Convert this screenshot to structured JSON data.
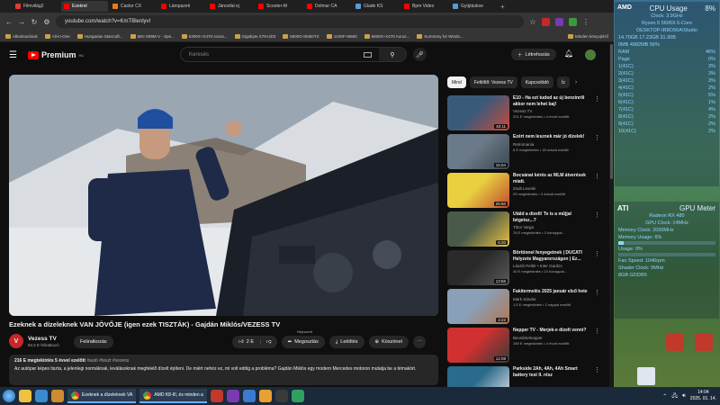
{
  "browser": {
    "tabs": [
      {
        "label": "Filmvilág2",
        "color": "#e53935"
      },
      {
        "label": "Ezekrel",
        "color": "#ff0000",
        "active": true
      },
      {
        "label": "Castor CX",
        "color": "#e87d18"
      },
      {
        "label": "Lámpazeti",
        "color": "#ff0000"
      },
      {
        "label": "Jánosfal ej",
        "color": "#ff0000"
      },
      {
        "label": "Scooter-M",
        "color": "#ff0000"
      },
      {
        "label": "Dolmar CA",
        "color": "#ff0000"
      },
      {
        "label": "Glade KS",
        "color": "#5b9bd5"
      },
      {
        "label": "Bpm Video",
        "color": "#ff0000"
      },
      {
        "label": "Gyújtáskoe",
        "color": "#5b9bd5"
      }
    ],
    "url": "youtube.com/watch?v=KmTBlenlyvI",
    "bookmarks": [
      "Alkalmazások",
      "All-in-One",
      "Hungarian Starcraft...",
      "MSI X99M-V - Spe...",
      "5300X+X470 Aorus...",
      "Gigabyte X79-UD3",
      "5600G+B350TX",
      "1240F+B660",
      "5600X+X470 Aorus...",
      "Summary for Windo..."
    ],
    "bookmarks_last": "Minden könyvjelző"
  },
  "youtube": {
    "logo": "Premium",
    "logo_sup": "HU",
    "search_placeholder": "Keresés",
    "create_label": "Létrehozás",
    "video_title": "Ezeknek a dízeleknek VAN JÖVŐJE (igen ezek TISZTÁK) - Gajdán Miklós/VEZESS TV",
    "channel": {
      "initial": "V",
      "name": "Vezess TV",
      "subs": "92,5 E feliratkozó"
    },
    "subscribe_label": "Feliratkozás",
    "tooltip": "Népszerű",
    "actions": {
      "like": "2 E",
      "share": "Megosztás",
      "download": "Letöltés",
      "thanks": "Köszönet",
      "more": "⋯"
    },
    "description": {
      "meta": "216 E megtekintés  5 évvel ezelőtt",
      "tags": "#autó #teszt #vezess",
      "text": "Az autópar képes tiszta, a jelenlegi normáknak, leválásoknak megfelelő dízelt építeni. De miért nehéz ez, mi volt eddig a probléma? Gajdán Miklós egy modern Mercedes motoron mutatja be a témakört."
    },
    "chips": [
      "Mind",
      "Feltöltő: Vezess TV",
      "Kapcsolódó",
      "Íz"
    ],
    "recommendations": [
      {
        "title": "E10 - Ha ezt tudod az új benzinről akkor nem lehet baj!",
        "channel": "Vezess TV",
        "meta": "201 E megtekintés • 4 évvel ezelőtt",
        "duration": "40:11",
        "c1": "#3a5a7a",
        "c2": "#c84a3a"
      },
      {
        "title": "Ezért nem lesznek már jó dízelek!",
        "channel": "Retromania",
        "meta": "6 E megtekintés • 18 órával ezelőtt",
        "duration": "15:04",
        "c1": "#6b7a88",
        "c2": "#3a4650"
      },
      {
        "title": "Bocsánat kérés az MLM átverések miatt.",
        "channel": "Zsolt Levelei",
        "meta": "25 megtekintés • 3 órával ezelőtt",
        "duration": "25:50",
        "c1": "#e8d040",
        "c2": "#c04a30"
      },
      {
        "title": "Utáld a dízelt! Te is a műjjal bégetsz...?",
        "channel": "Tibor Varga",
        "meta": "76 E megtekintés • 3 hónappal...",
        "duration": "6:20",
        "c1": "#4a5a4a",
        "c2": "#e8c040"
      },
      {
        "title": "Börtönnel fenyegetnek | DUCATI Helyzete Magyarországon | Ez...",
        "channel": "László Pellér • Inter Gardzs",
        "meta": "40 E megtekintés • 10 hónappal...",
        "duration": "13:56",
        "c1": "#2a2a2a",
        "c2": "#5a5a5a"
      },
      {
        "title": "Fakitermelés 2025 január első hete",
        "channel": "Márk Sándor",
        "meta": "1,5 E megtekintés • 2 nappal ezelőtt",
        "duration": "4:22",
        "c1": "#8aa0b8",
        "c2": "#b07850"
      },
      {
        "title": "Nepper TV - Merjek-e dízelt venni?",
        "channel": "Bevsűrtelnepper",
        "meta": "155 E megtekintés • 4 évvel ezelőtt",
        "duration": "12:08",
        "c1": "#d03030",
        "c2": "#3a3a3a"
      },
      {
        "title": "Parkside 2Ah, 4Ah, 4Ah Smart battery test II. rész",
        "channel": "",
        "meta": "",
        "duration": "",
        "c1": "#2a6a8a",
        "c2": "#e8e8e8"
      }
    ]
  },
  "cpu_gadget": {
    "title": "CPU Usage",
    "percent": "8%",
    "vendor": "AMD",
    "clock": "Clock: 3.9GHz",
    "model": "Ryzen 5 5600X 6-Core",
    "host": "DESKTOP-IR8O56A\\Studio",
    "mem": "14.70GB   17.23GB   31.90B",
    "ram_row1": "0MB    4982MB    56%",
    "ram_label": "RAM",
    "ram_pct": "46%",
    "page_label": "Page",
    "page_pct": "0%",
    "cores": [
      {
        "label": "1(41C)",
        "pct": "3%",
        "fill": 0.03
      },
      {
        "label": "2(41C)",
        "pct": "3%",
        "fill": 0.03
      },
      {
        "label": "3(41C)",
        "pct": "3%",
        "fill": 0.03
      },
      {
        "label": "4(41C)",
        "pct": "2%",
        "fill": 0.02
      },
      {
        "label": "5(41C)",
        "pct": "5%",
        "fill": 0.05
      },
      {
        "label": "6(41C)",
        "pct": "1%",
        "fill": 0.01
      },
      {
        "label": "7(41C)",
        "pct": "4%",
        "fill": 0.04
      },
      {
        "label": "8(41C)",
        "pct": "2%",
        "fill": 0.02
      },
      {
        "label": "9(41C)",
        "pct": "2%",
        "fill": 0.02
      },
      {
        "label": "10(41C)",
        "pct": "2%",
        "fill": 0.02
      }
    ]
  },
  "gpu_gadget": {
    "title": "GPU Meter",
    "vendor": "ATI",
    "model": "Radeon RX 480",
    "gpu_clock": "GPU Clock: 14MHz",
    "mem_clock": "Memory Clock: 2000MHz",
    "mem_usage": "Memory Usage: 6%",
    "usage": "Usage: 0%",
    "fan": "Fan Speed: 1046rpm",
    "shader": "Shader Clock: 0MHz",
    "ram": "8GB GDDR5",
    "usage_fill": 0.0,
    "mem_fill": 0.06
  },
  "taskbar": {
    "app1": "Ezeknek a dízeleknek VA",
    "app2": "AMD K8-III, és minden a",
    "time": "14:04",
    "date": "2025. 01. 14."
  }
}
